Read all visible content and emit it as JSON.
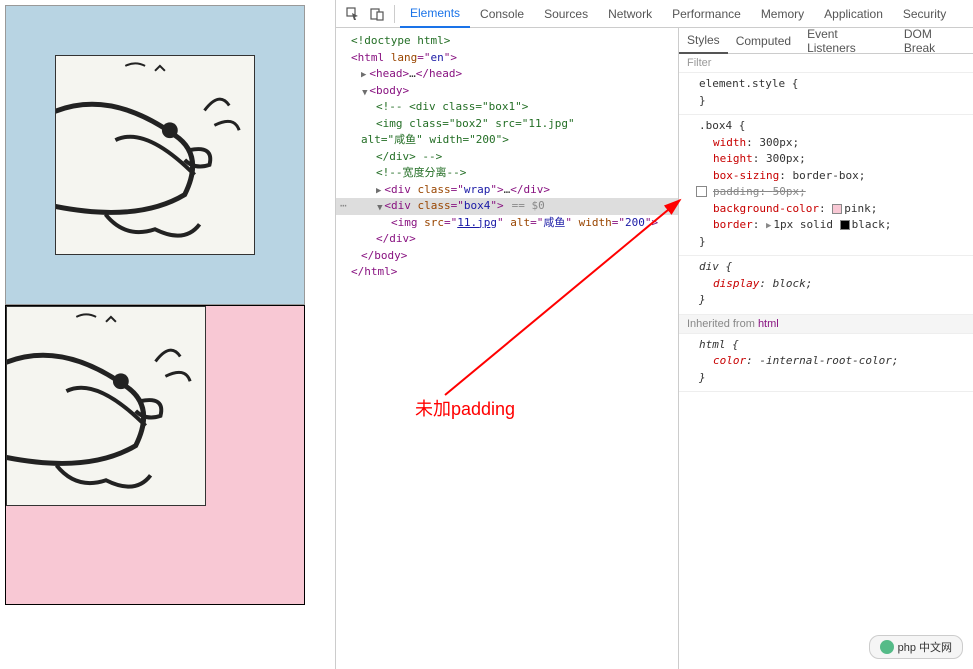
{
  "devtools": {
    "tabs": [
      "Elements",
      "Console",
      "Sources",
      "Network",
      "Performance",
      "Memory",
      "Application",
      "Security"
    ],
    "active_tab": "Elements"
  },
  "dom": {
    "doctype": "<!doctype html>",
    "html_open": "html",
    "html_lang_attr": "lang",
    "html_lang_val": "en",
    "head": "head",
    "head_ellipsis": "…",
    "body": "body",
    "comment1": " <div class=\"box1\">",
    "comment2": "        <img class=\"box2\" src=\"11.jpg\"",
    "comment3": "alt=\"咸鱼\" width=\"200\">",
    "comment4": "    </div> ",
    "comment5": "宽度分离",
    "div_wrap_class": "wrap",
    "div_box4_class": "box4",
    "eq_zero": "== $0",
    "img_src": "11.jpg",
    "img_alt": "咸鱼",
    "img_width": "200",
    "div": "div",
    "img": "img",
    "html": "html",
    "class_attr": "class",
    "src_attr": "src",
    "alt_attr": "alt",
    "width_attr": "width"
  },
  "styles": {
    "tabs": [
      "Styles",
      "Computed",
      "Event Listeners",
      "DOM Break"
    ],
    "active_tab": "Styles",
    "filter_placeholder": "Filter",
    "element_style": "element.style",
    "box4_selector": ".box4",
    "rules": {
      "width": {
        "name": "width",
        "value": "300px"
      },
      "height": {
        "name": "height",
        "value": "300px"
      },
      "box_sizing": {
        "name": "box-sizing",
        "value": "border-box"
      },
      "padding": {
        "name": "padding",
        "value": "50px"
      },
      "bg": {
        "name": "background-color",
        "value": "pink",
        "swatch": "#f8c8d4"
      },
      "border": {
        "name": "border",
        "value": "1px solid",
        "color": "black",
        "swatch": "#000"
      }
    },
    "div_rule": {
      "selector": "div",
      "display_name": "display",
      "display_value": "block"
    },
    "inherited_label": "Inherited from",
    "inherited_from": "html",
    "html_rule": {
      "selector": "html",
      "color_name": "color",
      "color_value": "-internal-root-color"
    }
  },
  "annotation": "未加padding",
  "badge": {
    "text": "php 中文网"
  }
}
